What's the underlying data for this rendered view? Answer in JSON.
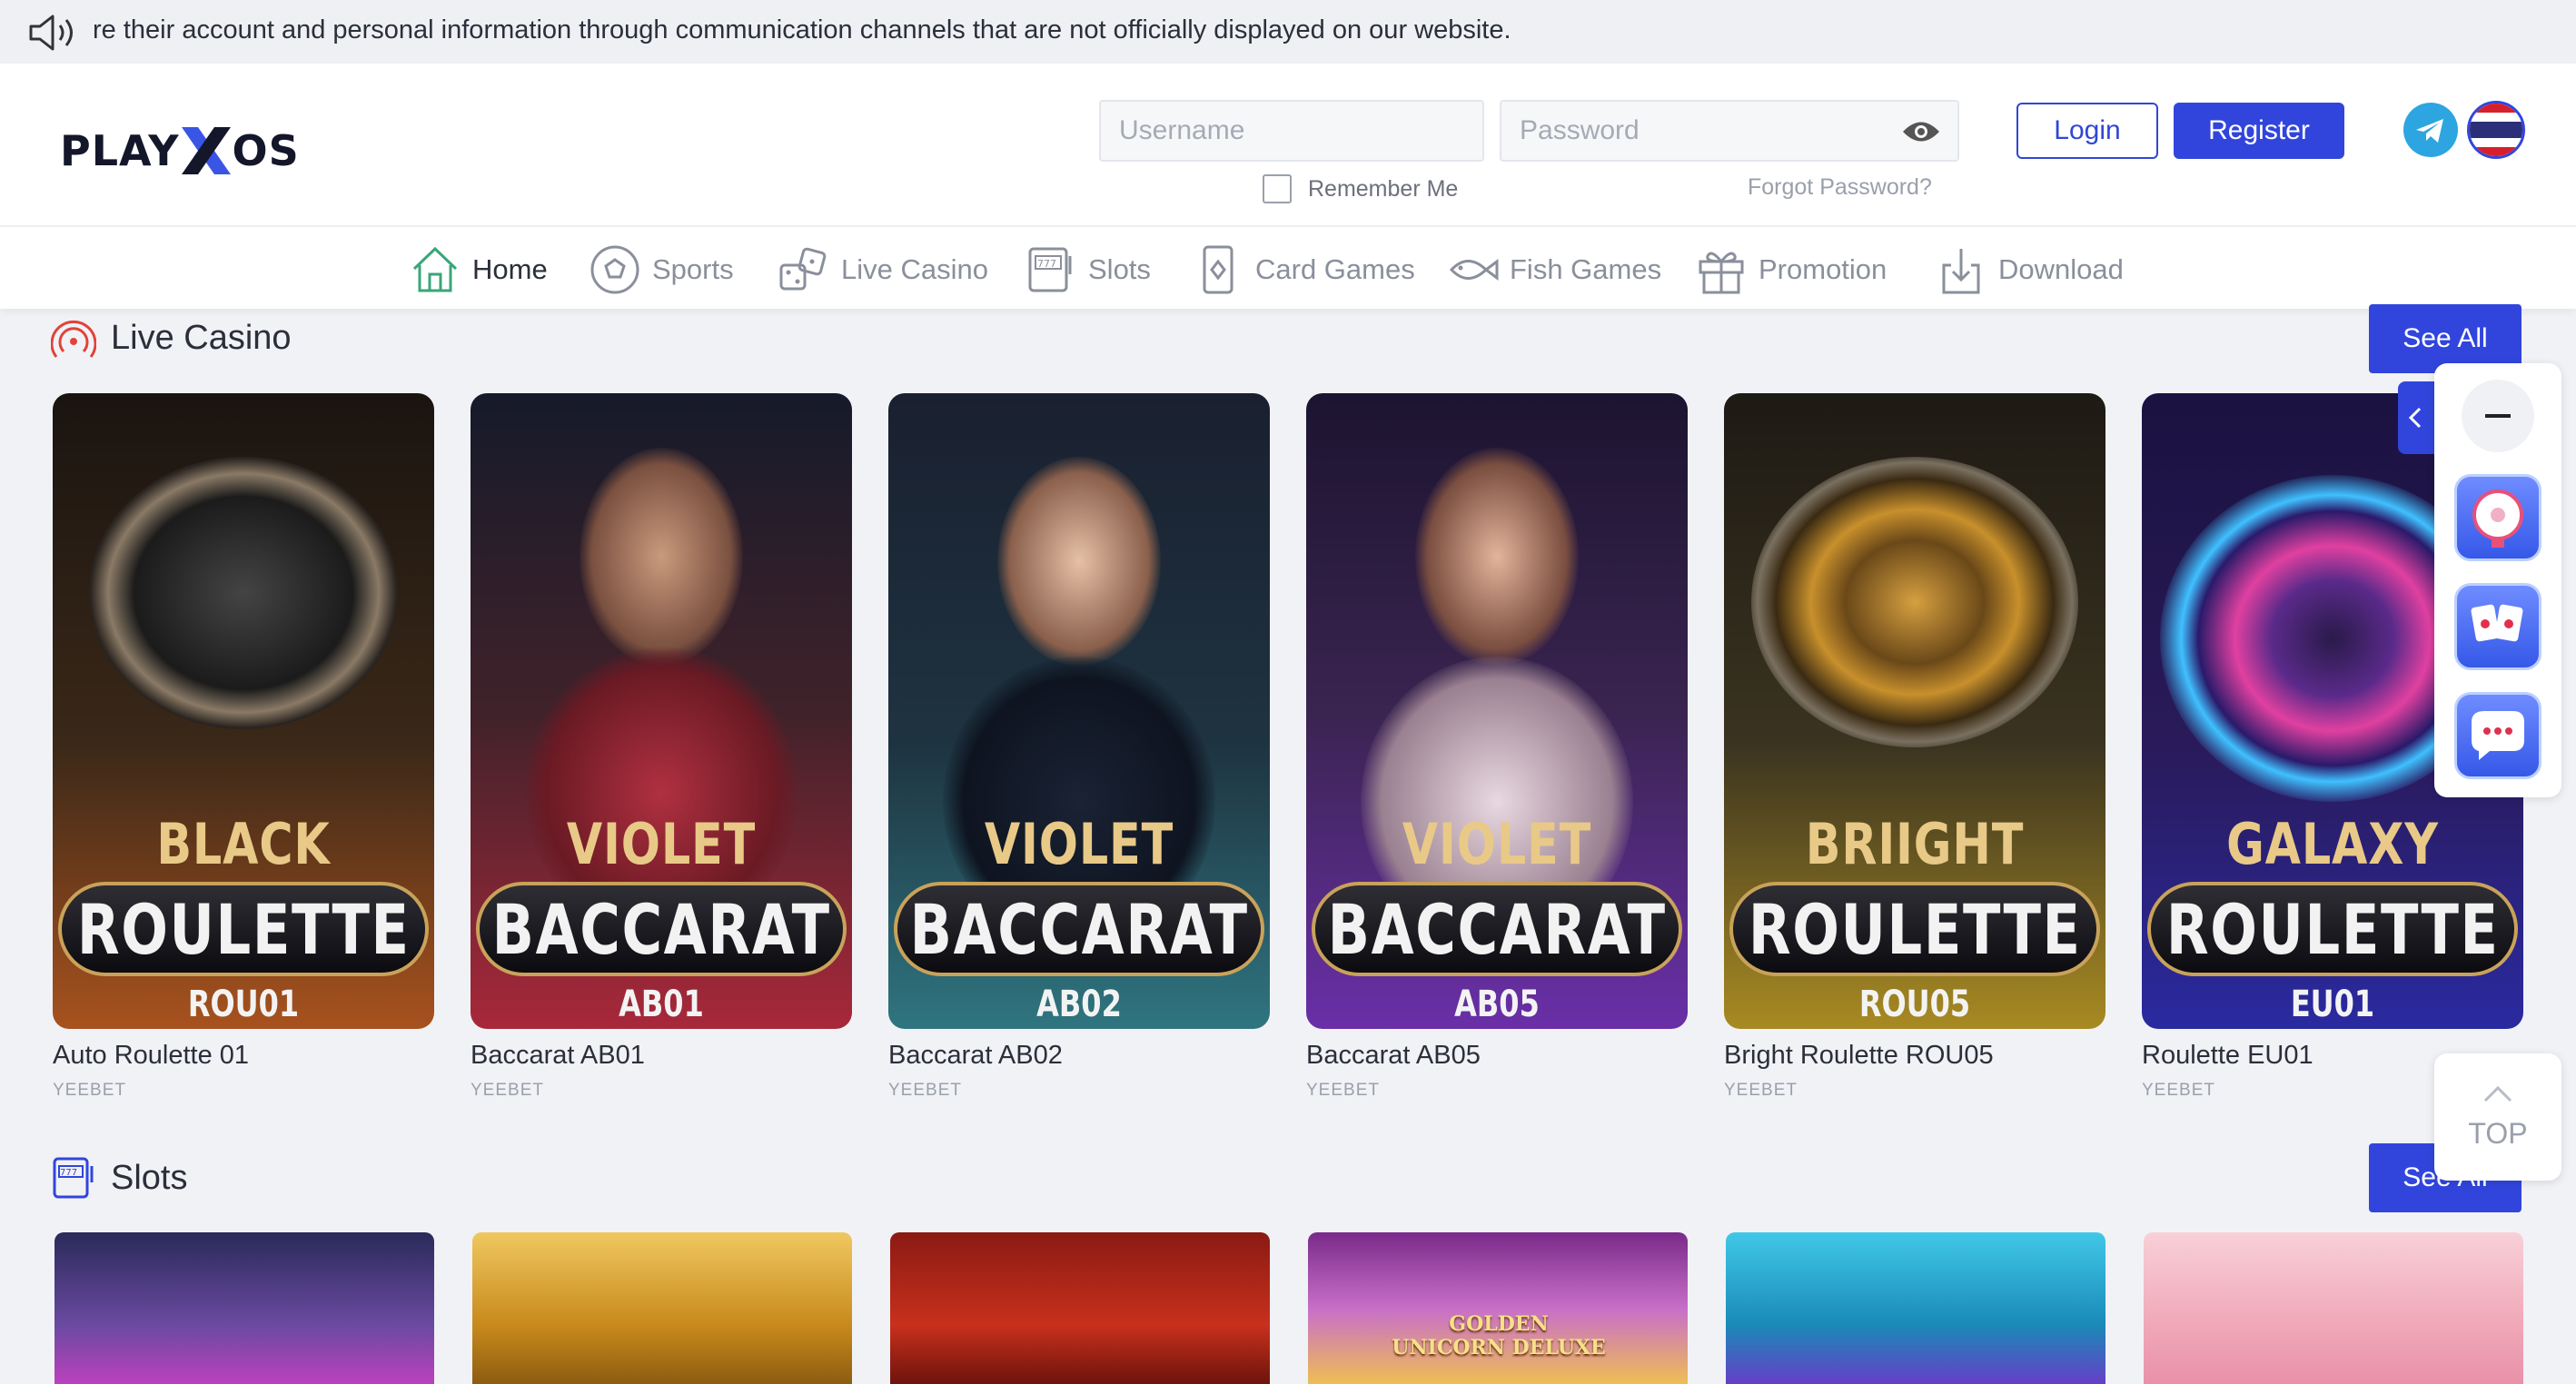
{
  "announcement": {
    "icon": "speaker-icon",
    "text": "re their account and personal information through communication channels that are not officially displayed on our website."
  },
  "header": {
    "logo": {
      "part1": "PLAY",
      "part2": "OS"
    },
    "username_placeholder": "Username",
    "password_placeholder": "Password",
    "remember_label": "Remember Me",
    "forgot_label": "Forgot Password?",
    "login_label": "Login",
    "register_label": "Register"
  },
  "nav": [
    {
      "label": "Home",
      "icon": "home-icon"
    },
    {
      "label": "Sports",
      "icon": "soccer-ball-icon"
    },
    {
      "label": "Live Casino",
      "icon": "dice-icon"
    },
    {
      "label": "Slots",
      "icon": "slot-machine-icon"
    },
    {
      "label": "Card Games",
      "icon": "card-icon"
    },
    {
      "label": "Fish Games",
      "icon": "fish-icon"
    },
    {
      "label": "Promotion",
      "icon": "gift-icon"
    },
    {
      "label": "Download",
      "icon": "download-icon"
    }
  ],
  "live_casino": {
    "title": "Live Casino",
    "see_all": "See All",
    "games": [
      {
        "tag": "BLACK",
        "type": "ROULETTE",
        "code": "ROU01",
        "name": "Auto Roulette 01",
        "provider": "YEEBET"
      },
      {
        "tag": "VIOLET",
        "type": "BACCARAT",
        "code": "AB01",
        "name": "Baccarat AB01",
        "provider": "YEEBET"
      },
      {
        "tag": "VIOLET",
        "type": "BACCARAT",
        "code": "AB02",
        "name": "Baccarat AB02",
        "provider": "YEEBET"
      },
      {
        "tag": "VIOLET",
        "type": "BACCARAT",
        "code": "AB05",
        "name": "Baccarat AB05",
        "provider": "YEEBET"
      },
      {
        "tag": "BRIIGHT",
        "type": "ROULETTE",
        "code": "ROU05",
        "name": "Bright Roulette ROU05",
        "provider": "YEEBET"
      },
      {
        "tag": "GALAXY",
        "type": "ROULETTE",
        "code": "EU01",
        "name": "Roulette EU01",
        "provider": "YEEBET"
      }
    ]
  },
  "slots": {
    "title": "Slots",
    "see_all": "See All",
    "thumb_text": "GOLDEN UNICORN DELUXE"
  },
  "floating": {
    "top_label": "TOP"
  },
  "colors": {
    "accent": "#3145dd",
    "background": "#f1f2f6",
    "gold": "#c9a25a"
  }
}
